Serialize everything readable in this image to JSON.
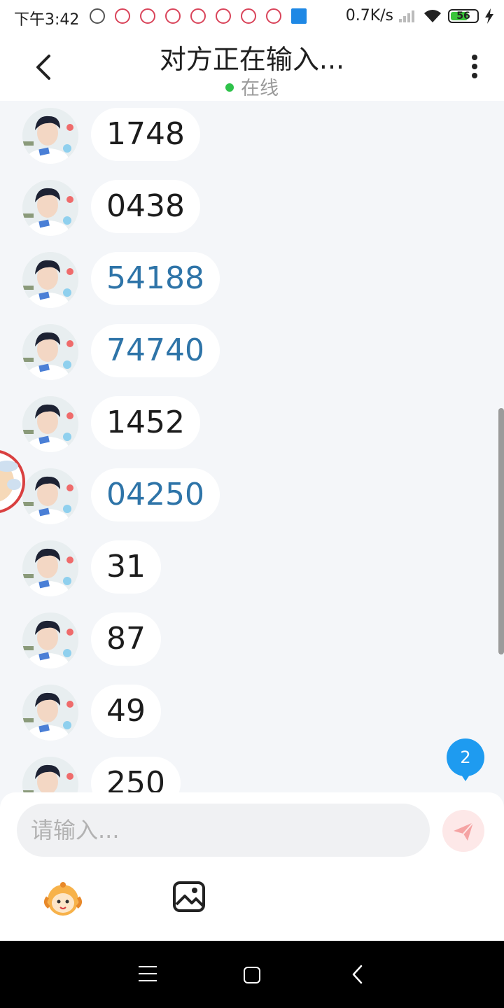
{
  "status_bar": {
    "time": "下午3:42",
    "net_speed": "0.7K/s",
    "battery_level": "56",
    "icons": [
      "recorder-icon",
      "app-notification-icon",
      "app-notification-icon",
      "app-notification-icon",
      "app-notification-icon",
      "app-notification-icon",
      "app-notification-icon",
      "app-notification-icon",
      "mi-app-icon"
    ]
  },
  "header": {
    "title": "对方正在输入...",
    "status": "在线",
    "status_color": "#2ec24a"
  },
  "messages": [
    {
      "text": "1748",
      "link": false
    },
    {
      "text": "0438",
      "link": false
    },
    {
      "text": "54188",
      "link": true
    },
    {
      "text": "74740",
      "link": true
    },
    {
      "text": "1452",
      "link": false
    },
    {
      "text": "04250",
      "link": true
    },
    {
      "text": "31",
      "link": false
    },
    {
      "text": "87",
      "link": false
    },
    {
      "text": "49",
      "link": false
    },
    {
      "text": "250",
      "link": false
    }
  ],
  "unread_badge": "2",
  "input": {
    "placeholder": "请输入...",
    "value": ""
  },
  "toolbar": {
    "emoji_icon": "emoji-face-icon",
    "image_icon": "image-icon",
    "send_icon": "paper-plane-icon"
  },
  "colors": {
    "link_text": "#2e74a8",
    "badge": "#1e9bf0",
    "send_button_bg": "#fde8e8"
  }
}
